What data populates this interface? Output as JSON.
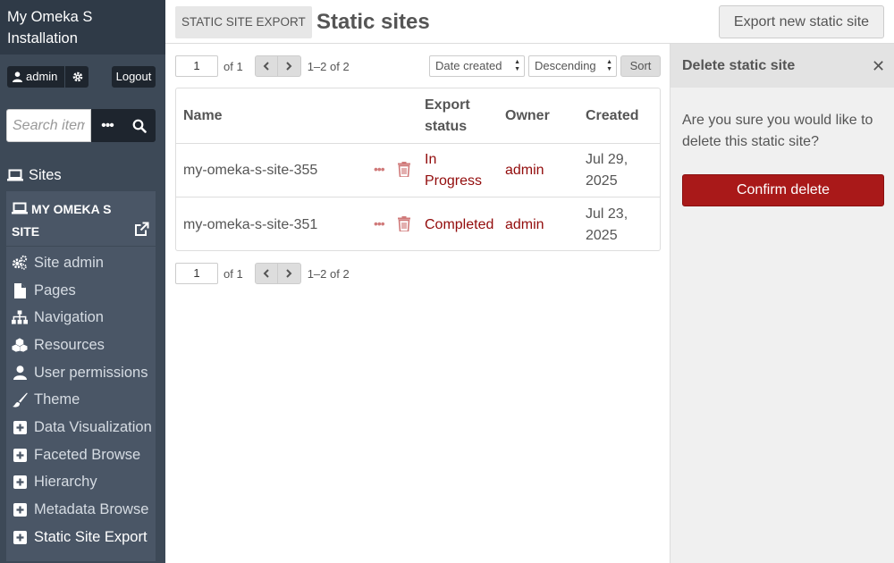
{
  "sidebar": {
    "install_title": "My Omeka S Installation",
    "user_label": "admin",
    "logout_label": "Logout",
    "search_placeholder": "Search items",
    "adv_search_label": "•••",
    "sites_label": "Sites",
    "site_name": "MY OMEKA S SITE",
    "nav_items": [
      {
        "label": "Site admin",
        "icon": "cogs-icon"
      },
      {
        "label": "Pages",
        "icon": "file-icon"
      },
      {
        "label": "Navigation",
        "icon": "sitemap-icon"
      },
      {
        "label": "Resources",
        "icon": "cubes-icon"
      },
      {
        "label": "User permissions",
        "icon": "user-icon"
      },
      {
        "label": "Theme",
        "icon": "paint-brush-icon"
      },
      {
        "label": "Data Visualization",
        "icon": "plus-square-icon"
      },
      {
        "label": "Faceted Browse",
        "icon": "plus-square-icon"
      },
      {
        "label": "Hierarchy",
        "icon": "plus-square-icon"
      },
      {
        "label": "Metadata Browse",
        "icon": "plus-square-icon"
      },
      {
        "label": "Static Site Export",
        "icon": "plus-square-icon"
      }
    ]
  },
  "header": {
    "module_tag": "STATIC SITE EXPORT",
    "title": "Static sites",
    "export_button": "Export new static site"
  },
  "pagination": {
    "page": "1",
    "of_label": "of 1",
    "range": "1–2 of 2"
  },
  "sort": {
    "sort_by": "Date created",
    "order": "Descending",
    "button": "Sort"
  },
  "table": {
    "headers": {
      "name": "Name",
      "status_line1": "Export",
      "status_line2": "status",
      "owner": "Owner",
      "created": "Created"
    },
    "rows": [
      {
        "name": "my-omeka-s-site-355",
        "status_line1": "In",
        "status_line2": "Progress",
        "owner": "admin",
        "created_line1": "Jul 29,",
        "created_line2": "2025"
      },
      {
        "name": "my-omeka-s-site-351",
        "status_line1": "Completed",
        "status_line2": "",
        "owner": "admin",
        "created_line1": "Jul 23,",
        "created_line2": "2025"
      }
    ]
  },
  "right_panel": {
    "title": "Delete static site",
    "close": "✕",
    "message": "Are you sure you would like to delete this static site?",
    "confirm_button": "Confirm delete"
  },
  "colors": {
    "sidebar_bg": "#3d4957",
    "link_red": "#920b0b",
    "danger_button": "#a91919"
  }
}
